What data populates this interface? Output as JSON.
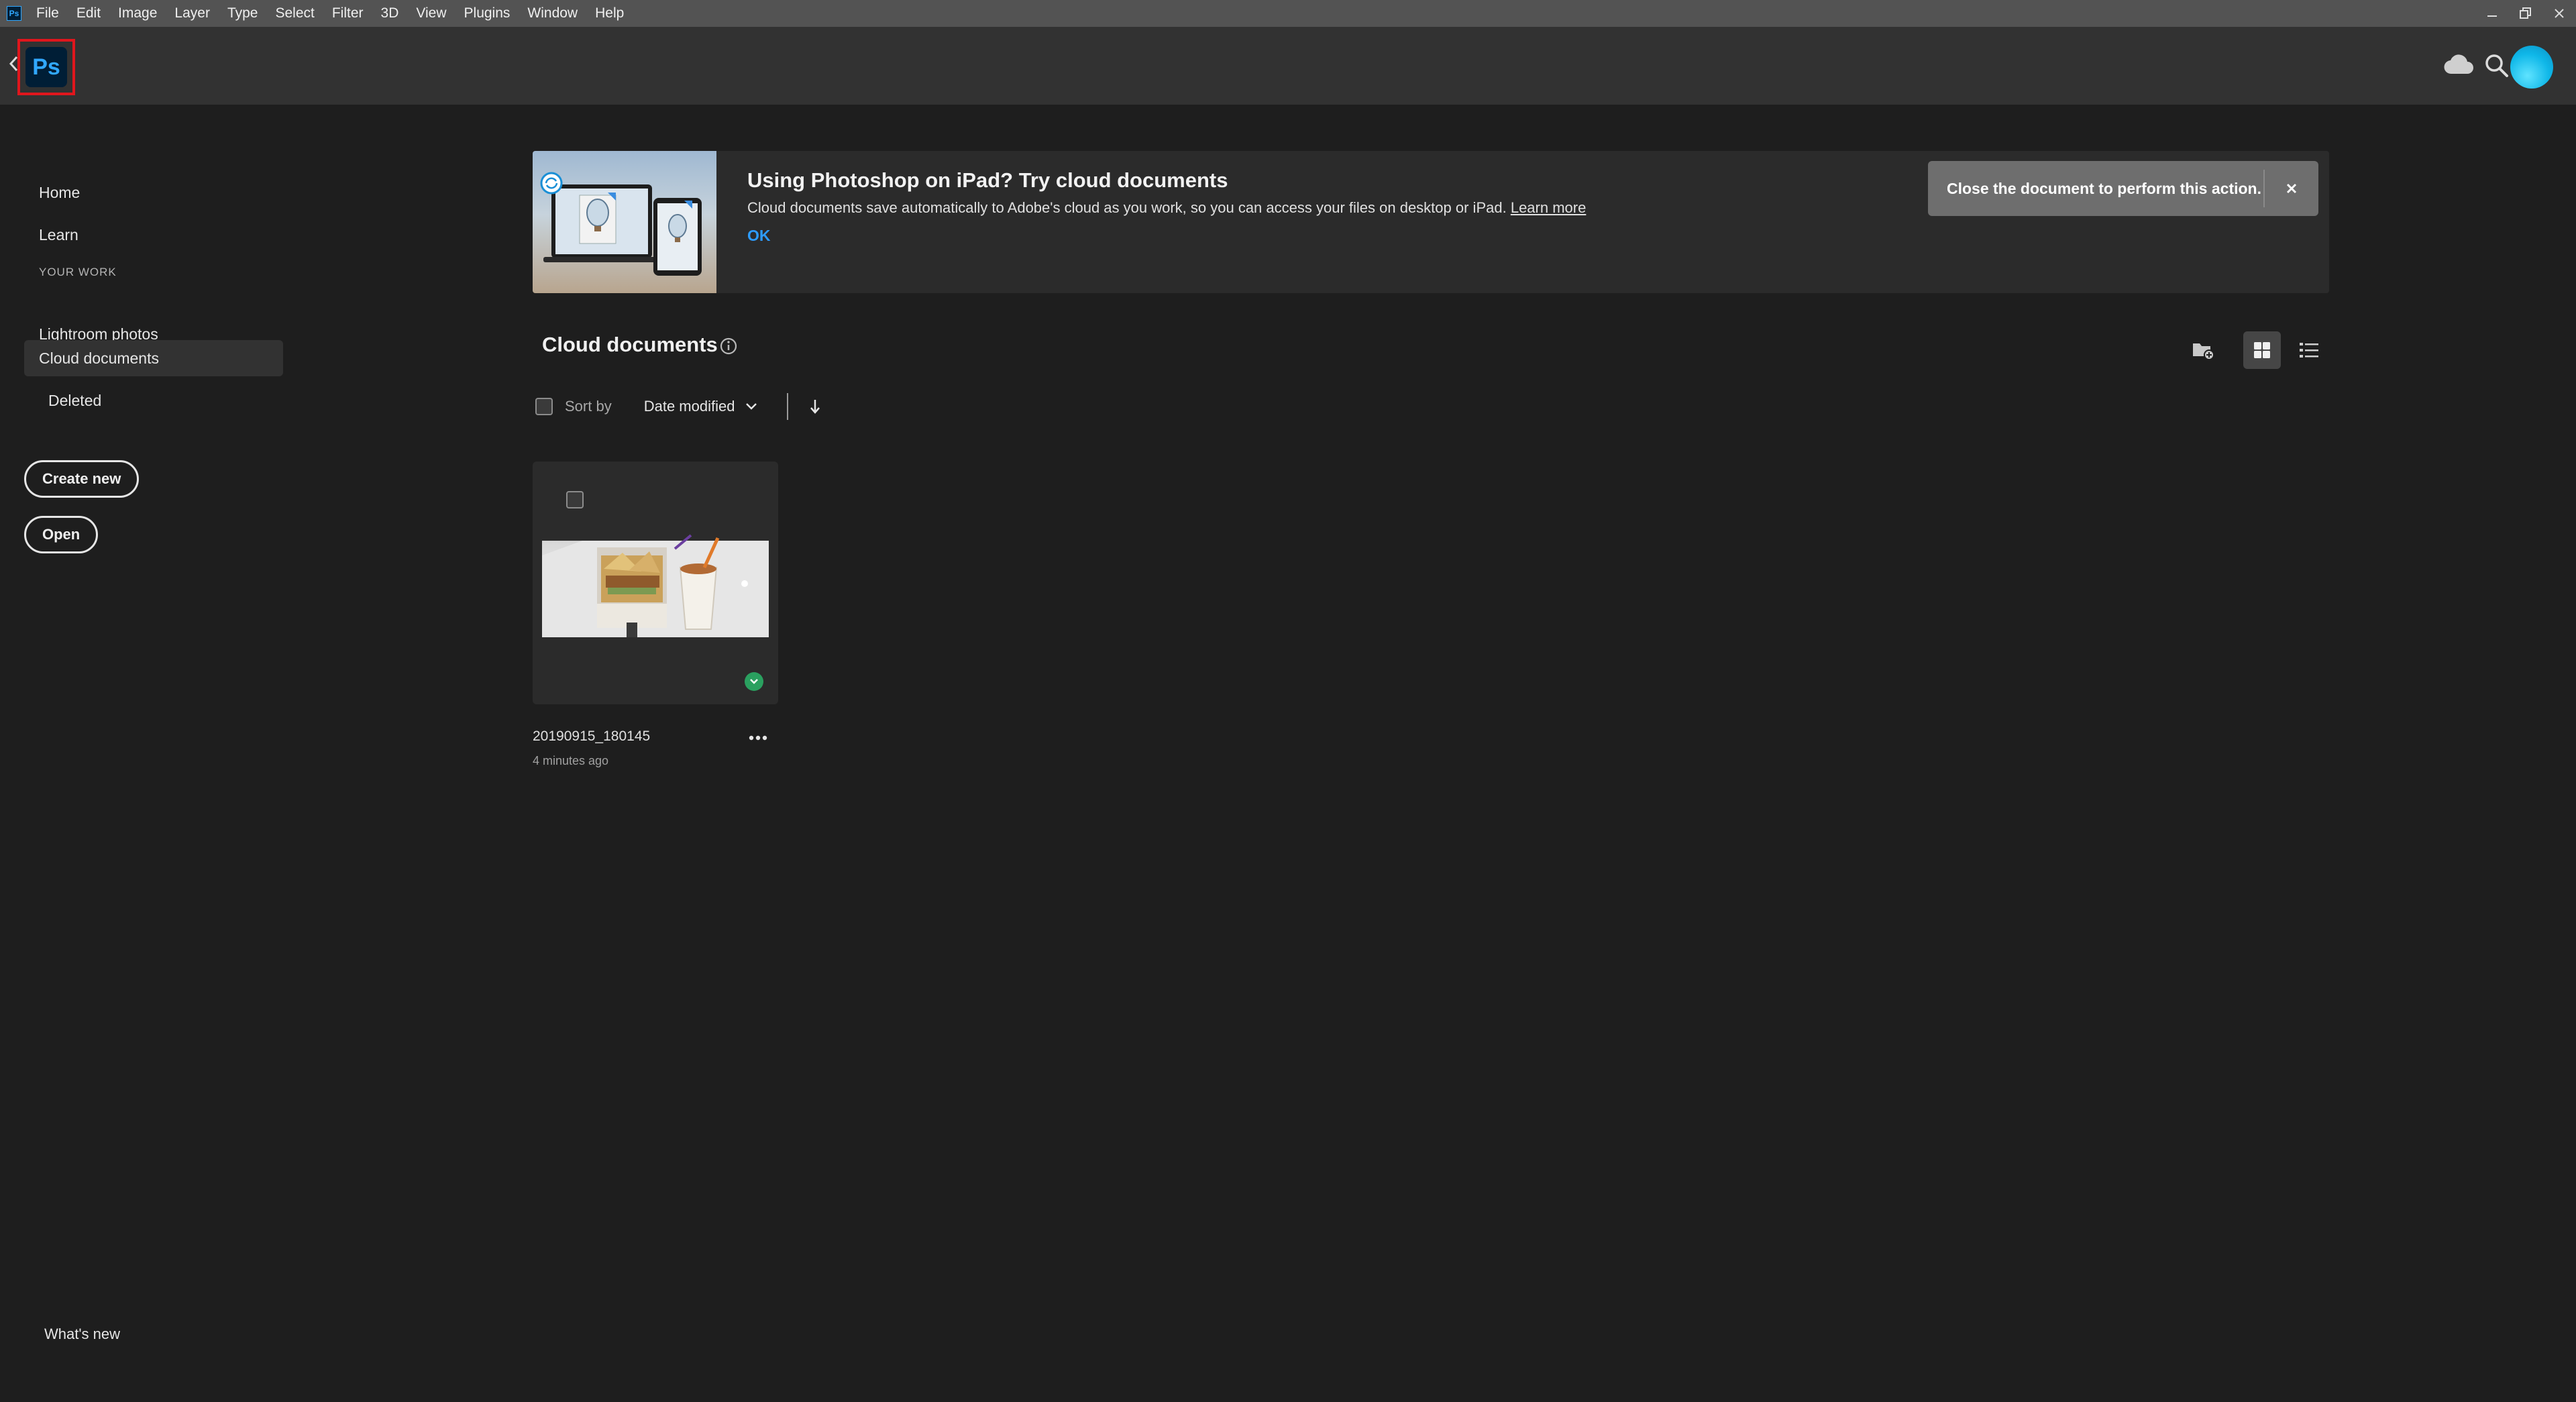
{
  "menubar": {
    "app_icon": "Ps",
    "items": [
      "File",
      "Edit",
      "Image",
      "Layer",
      "Type",
      "Select",
      "Filter",
      "3D",
      "View",
      "Plugins",
      "Window",
      "Help"
    ],
    "window_controls": [
      "minimize-icon",
      "restore-icon",
      "close-icon"
    ]
  },
  "header": {
    "logo_text": "Ps",
    "icons": [
      "cloud-icon",
      "search-icon"
    ]
  },
  "sidebar": {
    "nav": [
      {
        "label": "Home"
      },
      {
        "label": "Learn"
      }
    ],
    "section_label": "YOUR WORK",
    "work_items": [
      {
        "label": "Lightroom photos"
      },
      {
        "label": "Cloud documents",
        "active": true
      },
      {
        "label": "Deleted"
      }
    ],
    "create_new_label": "Create new",
    "open_label": "Open",
    "whats_new_label": "What's new"
  },
  "banner": {
    "title": "Using Photoshop on iPad? Try cloud documents",
    "description": "Cloud documents save automatically to Adobe's cloud as you work, so you can access your files on desktop or iPad.",
    "learn_more": "Learn more",
    "ok_label": "OK"
  },
  "toast": {
    "message": "Close the document to perform this action."
  },
  "content": {
    "title": "Cloud documents",
    "sort_label": "Sort by",
    "sort_value": "Date modified",
    "documents": [
      {
        "name": "20190915_180145",
        "modified": "4 minutes ago",
        "synced": true
      }
    ]
  },
  "colors": {
    "accent_blue": "#2d9cff",
    "ps_blue": "#31a8ff",
    "sync_green": "#2aa05f",
    "highlight_red": "#e0161d"
  }
}
